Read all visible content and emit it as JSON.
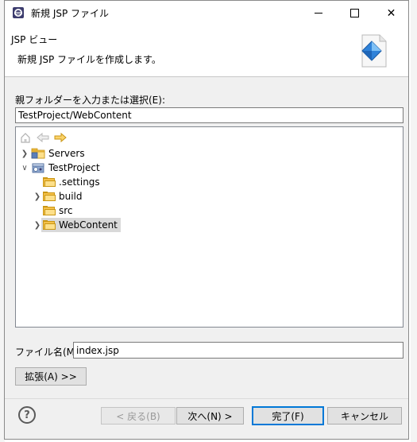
{
  "dialog": {
    "title": "新規 JSP ファイル",
    "minimize_glyph": "—",
    "maximize_glyph": "☐",
    "close_glyph": "✕"
  },
  "banner": {
    "heading": "JSP ビュー",
    "description": "新規 JSP ファイルを作成します。",
    "icon": "jsp-wizard-icon"
  },
  "parent_folder": {
    "label": "親フォルダーを入力または選択(E):",
    "value": "TestProject/WebContent"
  },
  "tree_toolbar": {
    "home_icon": "home-icon",
    "back_icon": "back-arrow-icon",
    "forward_icon": "forward-arrow-icon"
  },
  "tree": {
    "items": [
      {
        "label": "Servers",
        "expanded": false,
        "depth": 0,
        "kind": "project-folder"
      },
      {
        "label": "TestProject",
        "expanded": true,
        "depth": 0,
        "kind": "project"
      },
      {
        "label": ".settings",
        "depth": 1,
        "kind": "folder"
      },
      {
        "label": "build",
        "expanded": false,
        "depth": 1,
        "kind": "folder"
      },
      {
        "label": "src",
        "depth": 1,
        "kind": "folder"
      },
      {
        "label": "WebContent",
        "expanded": false,
        "depth": 1,
        "kind": "folder",
        "selected": true
      }
    ]
  },
  "file_name": {
    "label": "ファイル名(M):",
    "value": "index.jsp"
  },
  "buttons": {
    "advanced": "拡張(A) >>",
    "back": "< 戻る(B)",
    "next": "次へ(N) >",
    "finish": "完了(F)",
    "cancel": "キャンセル",
    "help_glyph": "?"
  },
  "colors": {
    "selection": "#d9d9d9",
    "default_button_border": "#0078d7"
  }
}
